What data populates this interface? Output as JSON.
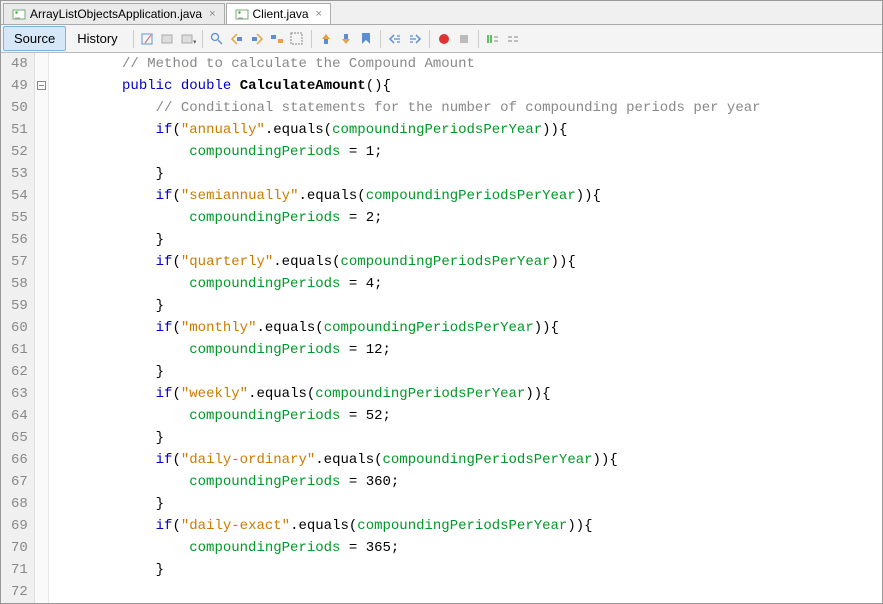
{
  "tabs": [
    {
      "label": "ArrayListObjectsApplication.java",
      "active": false
    },
    {
      "label": "Client.java",
      "active": true
    }
  ],
  "toolbar": {
    "source": "Source",
    "history": "History"
  },
  "lines": [
    {
      "num": 48,
      "fold": false,
      "html": "        <span class='c-comment'>// Method to calculate the Compound Amount</span>"
    },
    {
      "num": 49,
      "fold": true,
      "html": "        <span class='c-keyword'>public</span> <span class='c-keyword'>double</span> <span class='c-methodname'>CalculateAmount</span>(){"
    },
    {
      "num": 50,
      "fold": false,
      "html": "            <span class='c-comment'>// Conditional statements for the number of compounding periods per year</span>"
    },
    {
      "num": 51,
      "fold": false,
      "html": "            <span class='c-keyword'>if</span>(<span class='c-string'>\"annually\"</span>.equals(<span class='c-field'>compoundingPeriodsPerYear</span>)){"
    },
    {
      "num": 52,
      "fold": false,
      "html": "                <span class='c-field'>compoundingPeriods</span> = <span class='c-num'>1</span>;"
    },
    {
      "num": 53,
      "fold": false,
      "html": "            }"
    },
    {
      "num": 54,
      "fold": false,
      "html": "            <span class='c-keyword'>if</span>(<span class='c-string'>\"semiannually\"</span>.equals(<span class='c-field'>compoundingPeriodsPerYear</span>)){"
    },
    {
      "num": 55,
      "fold": false,
      "html": "                <span class='c-field'>compoundingPeriods</span> = <span class='c-num'>2</span>;"
    },
    {
      "num": 56,
      "fold": false,
      "html": "            }"
    },
    {
      "num": 57,
      "fold": false,
      "html": "            <span class='c-keyword'>if</span>(<span class='c-string'>\"quarterly\"</span>.equals(<span class='c-field'>compoundingPeriodsPerYear</span>)){"
    },
    {
      "num": 58,
      "fold": false,
      "html": "                <span class='c-field'>compoundingPeriods</span> = <span class='c-num'>4</span>;"
    },
    {
      "num": 59,
      "fold": false,
      "html": "            }"
    },
    {
      "num": 60,
      "fold": false,
      "html": "            <span class='c-keyword'>if</span>(<span class='c-string'>\"monthly\"</span>.equals(<span class='c-field'>compoundingPeriodsPerYear</span>)){"
    },
    {
      "num": 61,
      "fold": false,
      "html": "                <span class='c-field'>compoundingPeriods</span> = <span class='c-num'>12</span>;"
    },
    {
      "num": 62,
      "fold": false,
      "html": "            }"
    },
    {
      "num": 63,
      "fold": false,
      "html": "            <span class='c-keyword'>if</span>(<span class='c-string'>\"weekly\"</span>.equals(<span class='c-field'>compoundingPeriodsPerYear</span>)){"
    },
    {
      "num": 64,
      "fold": false,
      "html": "                <span class='c-field'>compoundingPeriods</span> = <span class='c-num'>52</span>;"
    },
    {
      "num": 65,
      "fold": false,
      "html": "            }"
    },
    {
      "num": 66,
      "fold": false,
      "html": "            <span class='c-keyword'>if</span>(<span class='c-string'>\"daily-ordinary\"</span>.equals(<span class='c-field'>compoundingPeriodsPerYear</span>)){"
    },
    {
      "num": 67,
      "fold": false,
      "html": "                <span class='c-field'>compoundingPeriods</span> = <span class='c-num'>360</span>;"
    },
    {
      "num": 68,
      "fold": false,
      "html": "            }"
    },
    {
      "num": 69,
      "fold": false,
      "html": "            <span class='c-keyword'>if</span>(<span class='c-string'>\"daily-exact\"</span>.equals(<span class='c-field'>compoundingPeriodsPerYear</span>)){"
    },
    {
      "num": 70,
      "fold": false,
      "html": "                <span class='c-field'>compoundingPeriods</span> = <span class='c-num'>365</span>;"
    },
    {
      "num": 71,
      "fold": false,
      "html": "            }"
    },
    {
      "num": 72,
      "fold": false,
      "html": ""
    }
  ]
}
